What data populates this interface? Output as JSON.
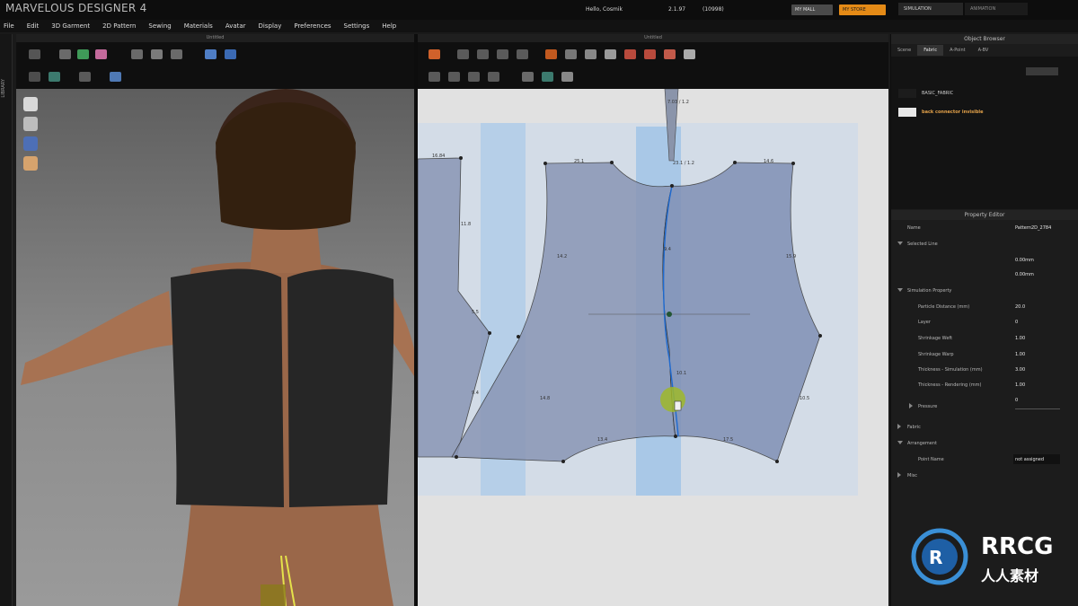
{
  "app": {
    "title": "MARVELOUS DESIGNER 4",
    "greeting": "Hello, Cosmik",
    "version": "2.1.97",
    "build": "(10998)",
    "my_mall_label": "MY MALL",
    "my_store_label": "MY STORE",
    "tabs": [
      "SIMULATION",
      "ANIMATION"
    ]
  },
  "menu": [
    "File",
    "Edit",
    "3D Garment",
    "2D Pattern",
    "Sewing",
    "Materials",
    "Avatar",
    "Display",
    "Preferences",
    "Settings",
    "Help"
  ],
  "library_label": "LIBRARY",
  "panel3d": {
    "title": "Untitled"
  },
  "panel2d": {
    "title": "Untitled"
  },
  "object_browser": {
    "title": "Object Browser",
    "tabs": [
      "Scene",
      "Fabric",
      "A-Point",
      "A-BV"
    ],
    "active_tab": "Fabric",
    "fabrics": [
      {
        "name": "BASIC_FABRIC",
        "color": "#1c1c1c"
      },
      {
        "name": "back connector invisible",
        "color": "#e8e8e8"
      }
    ]
  },
  "property_editor": {
    "title": "Property Editor",
    "name_label": "Name",
    "name_value": "Pattern2D_2784",
    "selected_line": "Selected Line",
    "rows_a": [
      {
        "label": "",
        "value": "0.00mm"
      },
      {
        "label": "",
        "value": "0.00mm"
      }
    ],
    "simulation_property": "Simulation Property",
    "sim_rows": [
      {
        "label": "Particle Distance (mm)",
        "value": "20.0"
      },
      {
        "label": "Layer",
        "value": "0"
      },
      {
        "label": "Shrinkage Weft",
        "value": "1.00"
      },
      {
        "label": "Shrinkage Warp",
        "value": "1.00"
      },
      {
        "label": "Thickness - Simulation (mm)",
        "value": "3.00"
      },
      {
        "label": "Thickness - Rendering (mm)",
        "value": "1.00"
      },
      {
        "label": "",
        "value": "0"
      }
    ],
    "pressure": "Pressure",
    "fabric": "Fabric",
    "arrangement": "Arrangement",
    "point_name_label": "Point Name",
    "point_name_value": "not assigned",
    "misc": "Misc"
  },
  "watermark": {
    "brand": "RRCG",
    "subtitle": "人人素材"
  },
  "pattern_labels": [
    "7.03 / 1.2",
    "16.84",
    "23.1 / 1.2",
    "25.1",
    "14.6",
    "11.8",
    "14.2",
    "15.9",
    "9.4",
    "5.5",
    "10.1",
    "9.4",
    "14.8",
    "10.5",
    "13.4",
    "17.5",
    "14.8",
    "15.06",
    "14.6"
  ],
  "colors": {
    "accent": "#e48a16",
    "pattern_fill": "#8a96b5",
    "selection_blue": "#8fbde8"
  }
}
